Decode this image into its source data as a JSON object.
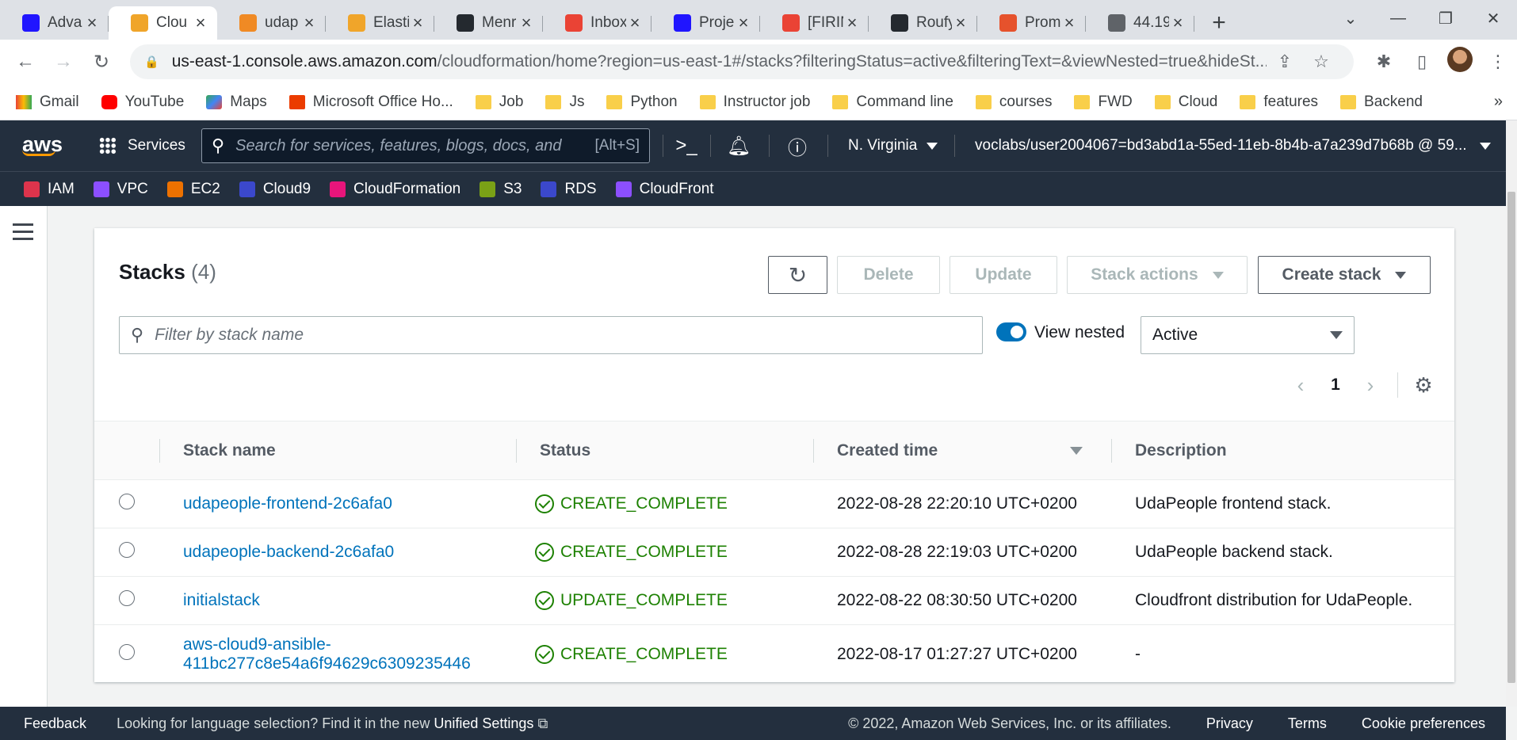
{
  "browser": {
    "tabs": [
      {
        "title": "Adva",
        "icon": "udacity-icon",
        "color": "#2015ff"
      },
      {
        "title": "Clou",
        "icon": "aws-box-icon",
        "color": "#f0a52a",
        "active": true
      },
      {
        "title": "udap",
        "icon": "aws-box-icon",
        "color": "#f08a24"
      },
      {
        "title": "Elasti",
        "icon": "aws-box-icon",
        "color": "#f0a52a"
      },
      {
        "title": "Menr",
        "icon": "github-icon",
        "color": "#24292f"
      },
      {
        "title": "Inbox",
        "icon": "gmail-icon",
        "color": "#ea4335"
      },
      {
        "title": "Proje",
        "icon": "udacity-icon",
        "color": "#2015ff"
      },
      {
        "title": "[FIRIN",
        "icon": "gmail-icon",
        "color": "#ea4335"
      },
      {
        "title": "Roufy",
        "icon": "github-icon",
        "color": "#24292f"
      },
      {
        "title": "Prom",
        "icon": "prometheus-icon",
        "color": "#e6522c"
      },
      {
        "title": "44.19",
        "icon": "globe-icon",
        "color": "#5f6368"
      }
    ],
    "url_domain": "us-east-1.console.aws.amazon.com",
    "url_path": "/cloudformation/home?region=us-east-1#/stacks?filteringStatus=active&filteringText=&viewNested=true&hideSt...",
    "bookmarks": [
      {
        "label": "Gmail",
        "icon": "gm"
      },
      {
        "label": "YouTube",
        "icon": "yt"
      },
      {
        "label": "Maps",
        "icon": "mp"
      },
      {
        "label": "Microsoft Office Ho...",
        "icon": "of"
      },
      {
        "label": "Job",
        "icon": "folder"
      },
      {
        "label": "Js",
        "icon": "folder"
      },
      {
        "label": "Python",
        "icon": "folder"
      },
      {
        "label": "Instructor job",
        "icon": "folder"
      },
      {
        "label": "Command line",
        "icon": "folder"
      },
      {
        "label": "courses",
        "icon": "folder"
      },
      {
        "label": "FWD",
        "icon": "folder"
      },
      {
        "label": "Cloud",
        "icon": "folder"
      },
      {
        "label": "features",
        "icon": "folder"
      },
      {
        "label": "Backend",
        "icon": "folder"
      }
    ]
  },
  "aws": {
    "logo": "aws",
    "services_label": "Services",
    "search_placeholder": "Search for services, features, blogs, docs, and",
    "search_shortcut": "[Alt+S]",
    "region": "N. Virginia",
    "account": "voclabs/user2004067=bd3abd1a-55ed-11eb-8b4b-a7a239d7b68b @ 59...",
    "favorites": [
      {
        "label": "IAM",
        "color": "#dd344c"
      },
      {
        "label": "VPC",
        "color": "#8c4fff"
      },
      {
        "label": "EC2",
        "color": "#ed7100"
      },
      {
        "label": "Cloud9",
        "color": "#3b48cc"
      },
      {
        "label": "CloudFormation",
        "color": "#e7157b"
      },
      {
        "label": "S3",
        "color": "#7aa116"
      },
      {
        "label": "RDS",
        "color": "#3b48cc"
      },
      {
        "label": "CloudFront",
        "color": "#8c4fff"
      }
    ]
  },
  "stacks": {
    "title": "Stacks",
    "count": "(4)",
    "delete_label": "Delete",
    "update_label": "Update",
    "actions_label": "Stack actions",
    "create_label": "Create stack",
    "filter_placeholder": "Filter by stack name",
    "view_nested_label": "View nested",
    "status_filter": "Active",
    "page": "1",
    "columns": [
      "Stack name",
      "Status",
      "Created time",
      "Description"
    ],
    "rows": [
      {
        "name": "udapeople-frontend-2c6afa0",
        "status": "CREATE_COMPLETE",
        "created": "2022-08-28 22:20:10 UTC+0200",
        "description": "UdaPeople frontend stack."
      },
      {
        "name": "udapeople-backend-2c6afa0",
        "status": "CREATE_COMPLETE",
        "created": "2022-08-28 22:19:03 UTC+0200",
        "description": "UdaPeople backend stack."
      },
      {
        "name": "initialstack",
        "status": "UPDATE_COMPLETE",
        "created": "2022-08-22 08:30:50 UTC+0200",
        "description": "Cloudfront distribution for UdaPeople."
      },
      {
        "name_line1": "aws-cloud9-ansible-",
        "name_line2": "411bc277c8e54a6f94629c6309235446",
        "status": "CREATE_COMPLETE",
        "created": "2022-08-17 01:27:27 UTC+0200",
        "description": "-"
      }
    ]
  },
  "footer": {
    "feedback": "Feedback",
    "lang_text": "Looking for language selection? Find it in the new",
    "lang_link": "Unified Settings",
    "copyright": "© 2022, Amazon Web Services, Inc. or its affiliates.",
    "privacy": "Privacy",
    "terms": "Terms",
    "cookies": "Cookie preferences"
  }
}
